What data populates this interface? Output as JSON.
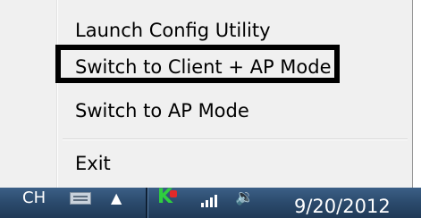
{
  "context_menu": {
    "items": [
      {
        "label": "Launch Config Utility"
      },
      {
        "label": "Switch to Client + AP Mode"
      },
      {
        "label": "Switch to AP Mode"
      },
      {
        "label": "Exit"
      }
    ],
    "highlighted_item": "Switch to Client + AP Mode"
  },
  "taskbar": {
    "language": "CH",
    "clock_date": "9/20/2012",
    "icons": {
      "keyboard": "keyboard-icon",
      "show_hidden": "show-hidden-icons-arrow",
      "app_tray": "wifi-utility-tray-icon",
      "network": "network-signal-icon",
      "volume": "volume-icon"
    },
    "show_hidden_glyph": "▲",
    "volume_glyph": "🔉"
  },
  "colors": {
    "menu_background": "#f0f0f0",
    "highlight_border": "#000000",
    "taskbar": "#2b4a6c",
    "tray_icon_green": "#2fcf3f",
    "tray_icon_red": "#e12a2a"
  }
}
